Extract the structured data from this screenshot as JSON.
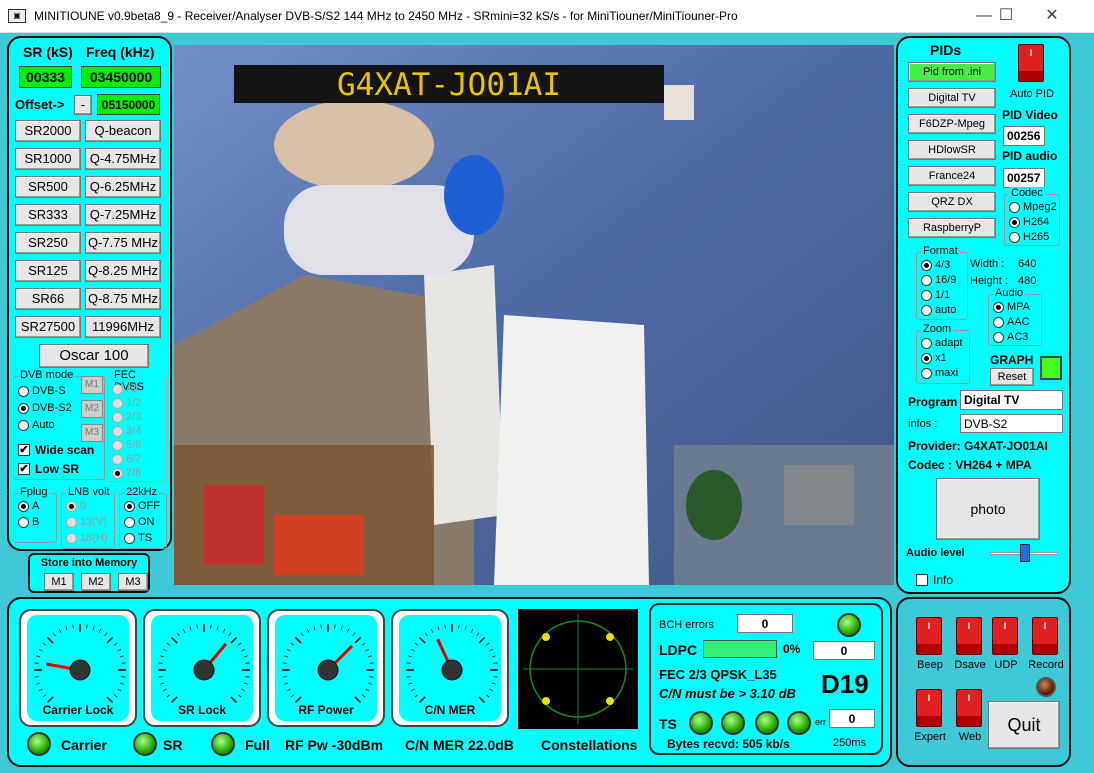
{
  "window": {
    "title": "MINITIOUNE v0.9beta8_9 - Receiver/Analyser DVB-S/S2 144 MHz to 2450 MHz - SRmini=32 kS/s - for MiniTiouner/MiniTiouner-Pro",
    "minimize": "—",
    "maximize": "☐",
    "close": "✕"
  },
  "left": {
    "sr_label": "SR (kS)",
    "freq_label": "Freq (kHz)",
    "sr_value": "00333",
    "freq_value": "03450000",
    "offset_label": "Offset->",
    "offset_sign": "-",
    "offset_value": "05150000",
    "presets": [
      [
        "SR2000",
        "Q-beacon"
      ],
      [
        "SR1000",
        "Q-4.75MHz"
      ],
      [
        "SR500",
        "Q-6.25MHz"
      ],
      [
        "SR333",
        "Q-7.25MHz"
      ],
      [
        "SR250",
        "Q-7.75 MHz"
      ],
      [
        "SR125",
        "Q-8.25 MHz"
      ],
      [
        "SR66",
        "Q-8.75 MHz"
      ],
      [
        "SR27500",
        "11996MHz"
      ]
    ],
    "oscar": "Oscar 100",
    "dvb_mode_title": "DVB mode",
    "dvb_modes": [
      "DVB-S",
      "DVB-S2",
      "Auto"
    ],
    "dvb_selected": 1,
    "m_buttons": [
      "M1",
      "M2",
      "M3"
    ],
    "fec_title": "FEC DVBS",
    "fec_options": [
      "All",
      "1/2",
      "2/3",
      "3/4",
      "5/6",
      "6/7",
      "7/8"
    ],
    "wide_scan": "Wide scan",
    "low_sr": "Low SR",
    "check_mark": "✔",
    "fplug_title": "Fplug",
    "fplug": [
      "A",
      "B"
    ],
    "lnb_title": "LNB volt",
    "lnb": [
      "0",
      "13(V)",
      "18(H)"
    ],
    "k22_title": "22kHz",
    "k22": [
      "OFF",
      "ON",
      "TS"
    ],
    "store_title": "Store into Memory",
    "store": [
      "M1",
      "M2",
      "M3"
    ]
  },
  "video": {
    "callsign": "G4XAT-JO01AI"
  },
  "right": {
    "pids_title": "PIDs",
    "pid_buttons": [
      "Pid from .ini",
      "Digital TV",
      "F6DZP-Mpeg",
      "HDlowSR",
      "France24",
      "QRZ DX",
      "RaspberryP"
    ],
    "auto_pid": "Auto PID",
    "pid_video_label": "PID Video",
    "pid_video": "00256",
    "pid_audio_label": "PID audio",
    "pid_audio": "00257",
    "codec_title": "Codec",
    "codecs": [
      "Mpeg2",
      "H264",
      "H265"
    ],
    "format_title": "Format",
    "formats": [
      "4/3",
      "16/9",
      "1/1",
      "auto"
    ],
    "width_label": "Width :",
    "width": "640",
    "height_label": "Height :",
    "height": "480",
    "audio_title": "Audio",
    "audios": [
      "MPA",
      "AAC",
      "AC3"
    ],
    "zoom_title": "Zoom",
    "zooms": [
      "adapt",
      "x1",
      "maxi"
    ],
    "graph_label": "GRAPH",
    "reset": "Reset",
    "program_label": "Program",
    "program": "Digital TV",
    "infos_label": "infos :",
    "infos": "DVB-S2",
    "provider": "Provider: G4XAT-JO01AI",
    "codec_line": "Codec :   VH264 + MPA",
    "photo": "photo",
    "audio_level": "Audio level",
    "info": "Info"
  },
  "bottom": {
    "gauges": [
      "Carrier Lock",
      "SR Lock",
      "RF Power",
      "C/N MER"
    ],
    "carrier": "Carrier",
    "sr": "SR",
    "full": "Full",
    "rf_pw": "RF Pw -30dBm",
    "cn_mer": "C/N MER 22.0dB",
    "constellations": "Constellations",
    "bch_label": "BCH errors",
    "bch_value": "0",
    "ldpc_label": "LDPC",
    "ldpc_pct": "0%",
    "ldpc_value": "0",
    "fec_line": "FEC  2/3 QPSK_L35",
    "cn_must": "C/N must be > 3.10 dB",
    "d_code": "D19",
    "ts_label": "TS",
    "err_label": "err",
    "err_value": "0",
    "bytes": "Bytes recvd:  505 kb/s",
    "ms": "250ms",
    "switches": [
      "Beep",
      "Dsave",
      "UDP",
      "Record",
      "Expert",
      "Web"
    ],
    "quit": "Quit"
  }
}
